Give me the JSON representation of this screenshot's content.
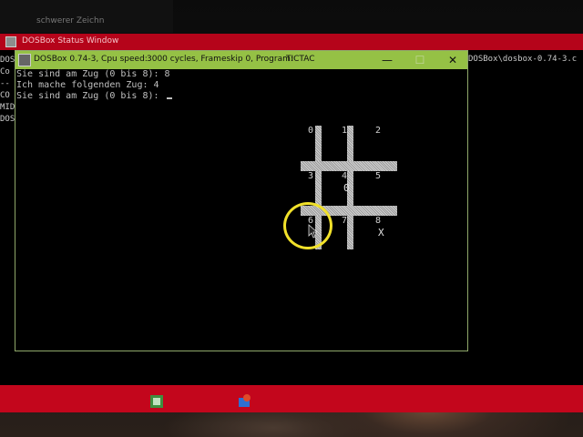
{
  "background": {
    "desc_color": "#2a201a"
  },
  "top_fragment": {
    "text": "schwerer Zeichn"
  },
  "status_window": {
    "title": "DOSBox Status Window",
    "side_lines": [
      "DOS",
      "Co",
      "--",
      "CO",
      "MID",
      "DOS"
    ],
    "right_path": "DOSBox\\dosbox-0.74-3.c"
  },
  "dosbox": {
    "title_app": "DOSBox 0.74-3, Cpu speed:",
    "title_cycles": "3000 cycles, Frameskip  0, Program:",
    "title_program": "TICTAC",
    "btn_minimize": "—",
    "btn_maximize": "☐",
    "btn_close": "✕",
    "lines": [
      "Sie sind am Zug (0 bis 8): 8",
      "Ich mache folgenden Zug: 4",
      "Sie sind am Zug (0 bis 8): "
    ]
  },
  "board": {
    "cells": [
      "0",
      "1",
      "2",
      "3",
      "4",
      "5",
      "6",
      "7",
      "8"
    ],
    "mark_o": "0",
    "mark_x": "X"
  },
  "colors": {
    "status_red": "#c3061c",
    "titlebar_green": "#95c145",
    "highlight_yellow": "#f1e12a"
  }
}
